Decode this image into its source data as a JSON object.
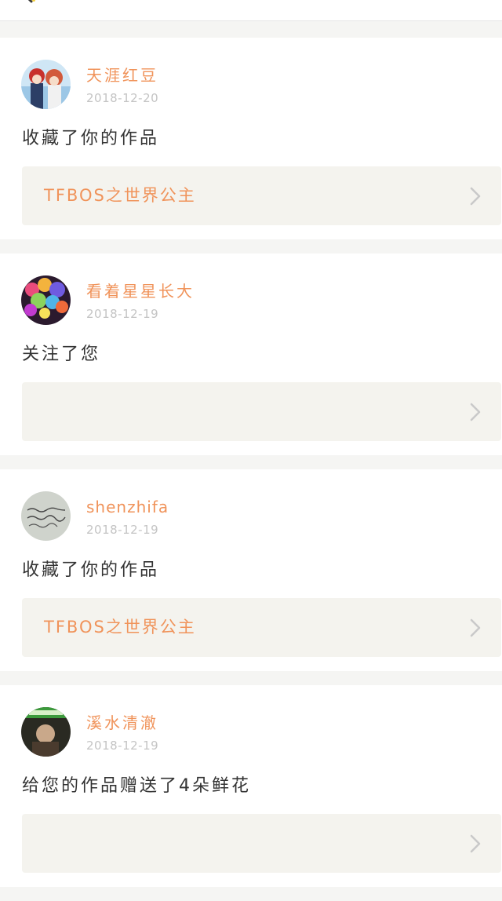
{
  "theme": {
    "accent": "#f0935a",
    "text": "#333333",
    "muted": "#c4c4c4",
    "panel": "#f4f3ee"
  },
  "header": {
    "back_icon": "arrow-left-icon",
    "title": ""
  },
  "feed": [
    {
      "username": "天涯红豆",
      "date": "2018-12-20",
      "action": "收藏了你的作品",
      "work_title": "TFBOS之世界公主",
      "avatar": "anime-couple-avatar"
    },
    {
      "username": "看着星星长大",
      "date": "2018-12-19",
      "action": "关注了您",
      "work_title": "",
      "avatar": "balloons-avatar"
    },
    {
      "username": "shenzhifa",
      "date": "2018-12-19",
      "action": "收藏了你的作品",
      "work_title": "TFBOS之世界公主",
      "avatar": "handwriting-avatar"
    },
    {
      "username": "溪水清澈",
      "date": "2018-12-19",
      "action": "给您的作品赠送了4朵鲜花",
      "work_title": "",
      "avatar": "portrait-avatar"
    }
  ]
}
